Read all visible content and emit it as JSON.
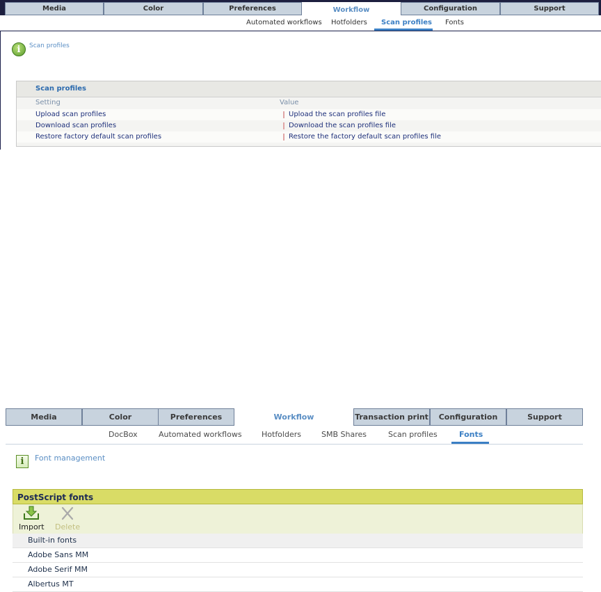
{
  "panel1": {
    "tabs": [
      "Media",
      "Color",
      "Preferences",
      "Workflow",
      "Configuration",
      "Support"
    ],
    "active_tab": "Workflow",
    "subtabs": [
      "Automated workflows",
      "Hotfolders",
      "Scan profiles",
      "Fonts"
    ],
    "active_subtab": "Scan profiles",
    "info_text": "Scan profiles",
    "card": {
      "title": "Scan profiles",
      "col_setting": "Setting",
      "col_value": "Value",
      "rows": [
        {
          "setting": "Upload scan profiles",
          "value": "Upload the scan profiles file"
        },
        {
          "setting": "Download scan profiles",
          "value": "Download the scan profiles file"
        },
        {
          "setting": "Restore factory default scan profiles",
          "value": "Restore the factory default scan profiles file"
        }
      ]
    }
  },
  "panel2": {
    "tabs": [
      "Media",
      "Color",
      "Preferences",
      "Workflow",
      "Transaction print",
      "Configuration",
      "Support"
    ],
    "active_tab": "Workflow",
    "subtabs": [
      "DocBox",
      "Automated workflows",
      "Hotfolders",
      "SMB Shares",
      "Scan profiles",
      "Fonts"
    ],
    "active_subtab": "Fonts",
    "info_text": "Font management",
    "card": {
      "title": "PostScript fonts",
      "toolbar": {
        "import": "Import",
        "delete": "Delete"
      },
      "group_label": "Built-in fonts",
      "rows": [
        "Adobe Sans MM",
        "Adobe Serif MM",
        "Albertus MT"
      ]
    }
  },
  "colors": {
    "accent": "#3b7fc4",
    "nav_dark": "#1d1f3f",
    "tab_bg": "#c8d3de",
    "card_header_yellow": "#d9dc66",
    "toolbar_bg": "#eef2d8"
  },
  "icons": {
    "info_icon": "info-icon",
    "import_icon": "import-icon",
    "delete_icon": "delete-icon"
  }
}
